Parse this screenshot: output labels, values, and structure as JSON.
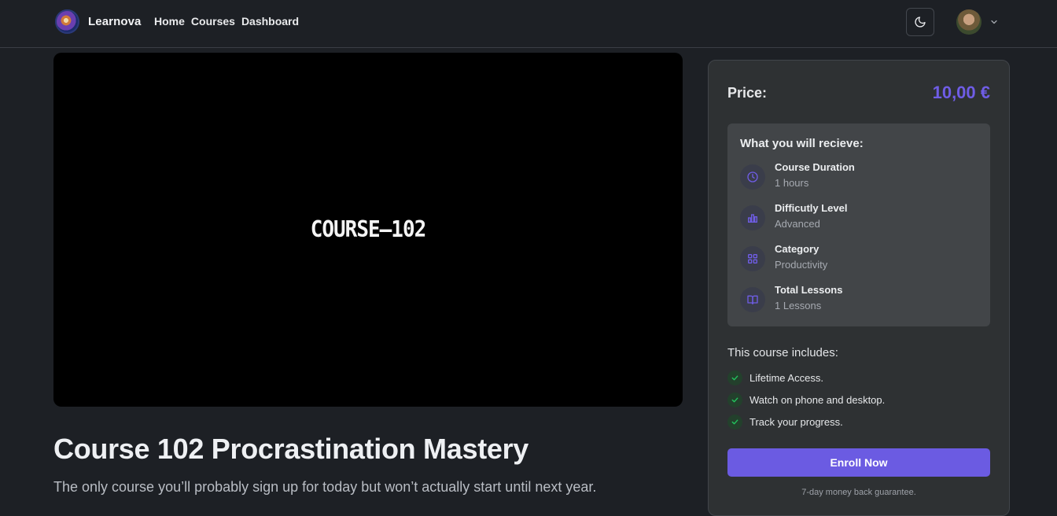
{
  "header": {
    "brand": "Learnova",
    "nav": [
      "Home",
      "Courses",
      "Dashboard"
    ]
  },
  "video": {
    "overlay_text": "COURSE–102"
  },
  "course": {
    "title": "Course 102 Procrastination Mastery",
    "description": "The only course you’ll probably sign up for today but won’t actually start until next year."
  },
  "sidebar": {
    "price_label": "Price:",
    "price_value": "10,00 €",
    "receive_title": "What you will recieve:",
    "info": [
      {
        "icon": "clock-icon",
        "label": "Course Duration",
        "value": "1 hours"
      },
      {
        "icon": "bar-chart-icon",
        "label": "Difficutly Level",
        "value": "Advanced"
      },
      {
        "icon": "grid-icon",
        "label": "Category",
        "value": "Productivity"
      },
      {
        "icon": "book-icon",
        "label": "Total Lessons",
        "value": "1 Lessons"
      }
    ],
    "includes_title": "This course includes:",
    "includes": [
      "Lifetime Access.",
      "Watch on phone and desktop.",
      "Track your progress."
    ],
    "enroll_label": "Enroll Now",
    "guarantee": "7-day money back guarantee."
  },
  "colors": {
    "background": "#1d2025",
    "accent": "#6b5be2",
    "card": "#2e3133",
    "check": "#22c55e"
  }
}
